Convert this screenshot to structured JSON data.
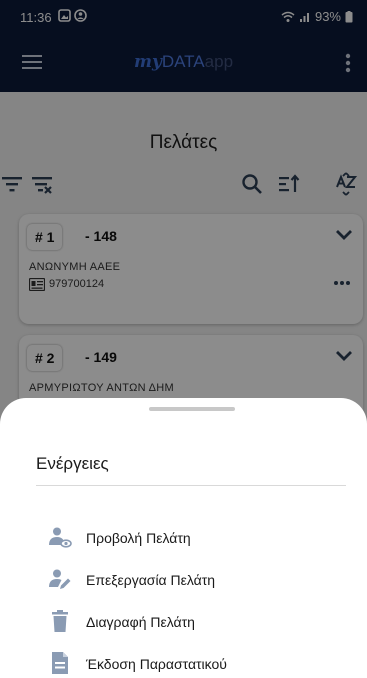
{
  "status_bar": {
    "time": "11:36",
    "battery": "93%"
  },
  "app_bar": {
    "logo_my": "my",
    "logo_data": "DATA",
    "logo_app": "app"
  },
  "page": {
    "title": "Πελάτες"
  },
  "customers": [
    {
      "index": "# 1",
      "code": "- 148",
      "name": "ΑΝΩΝΥΜΗ ΑΑΕΕ",
      "vat": "979700124"
    },
    {
      "index": "# 2",
      "code": "- 149",
      "name": "ΑΡΜΥΡΙΩΤΟΥ  ΑΝΤΩΝ ΔΗΜ"
    }
  ],
  "sheet": {
    "title": "Ενέργειες",
    "actions": [
      {
        "label": "Προβολή Πελάτη",
        "icon": "user-view-icon"
      },
      {
        "label": "Επεξεργασία Πελάτη",
        "icon": "user-edit-icon"
      },
      {
        "label": "Διαγραφή Πελάτη",
        "icon": "trash-icon"
      },
      {
        "label": "Έκδοση Παραστατικού",
        "icon": "document-icon"
      }
    ]
  },
  "colors": {
    "app_bar": "#0c1a3a",
    "icon_gray": "#8a9bb3",
    "text_dark": "#1a1a1a"
  }
}
